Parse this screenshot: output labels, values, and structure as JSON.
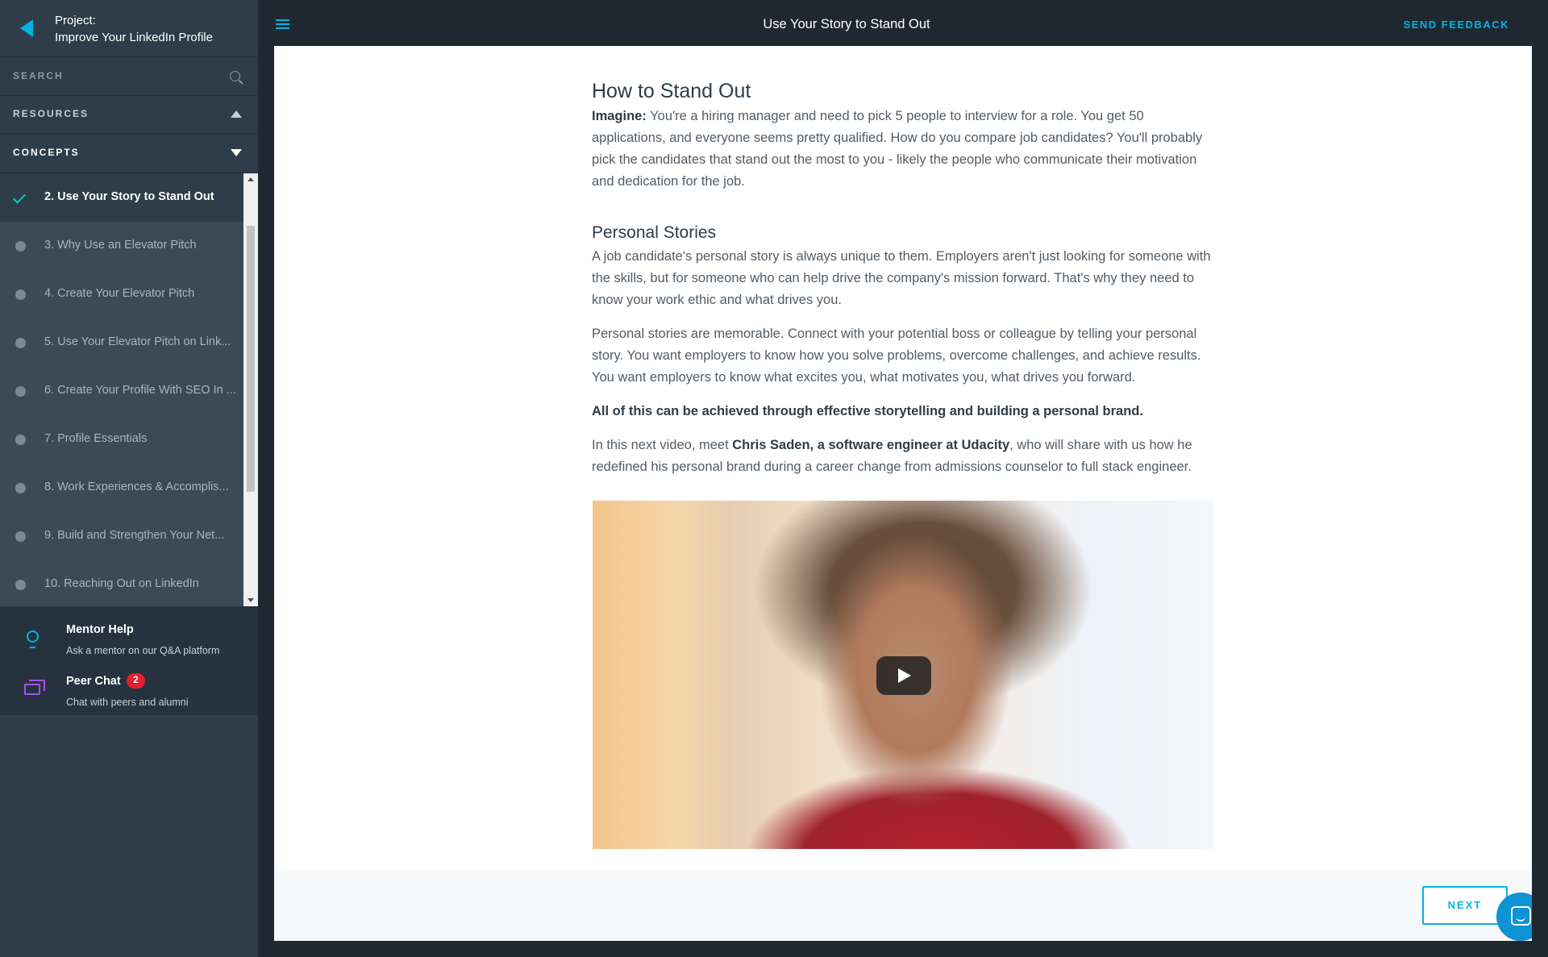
{
  "sidebar": {
    "project_label": "Project:",
    "project_name": "Improve Your LinkedIn Profile",
    "search_label": "SEARCH",
    "resources_label": "RESOURCES",
    "concepts_label": "CONCEPTS",
    "concepts": [
      {
        "label": "2. Use Your Story to Stand Out",
        "state": "completed-current"
      },
      {
        "label": "3. Why Use an Elevator Pitch",
        "state": "not-started"
      },
      {
        "label": "4. Create Your Elevator Pitch",
        "state": "not-started"
      },
      {
        "label": "5. Use Your Elevator Pitch on Link...",
        "state": "not-started"
      },
      {
        "label": "6. Create Your Profile With SEO In ...",
        "state": "not-started"
      },
      {
        "label": "7. Profile Essentials",
        "state": "not-started"
      },
      {
        "label": "8. Work Experiences & Accomplis...",
        "state": "not-started"
      },
      {
        "label": "9. Build and Strengthen Your Net...",
        "state": "not-started"
      },
      {
        "label": "10. Reaching Out on LinkedIn",
        "state": "not-started"
      }
    ],
    "mentor_help": {
      "title": "Mentor Help",
      "subtitle": "Ask a mentor on our Q&A platform",
      "icon": "lightbulb-icon"
    },
    "peer_chat": {
      "title": "Peer Chat",
      "badge": "2",
      "subtitle": "Chat with peers and alumni",
      "icon": "chat-bubbles-icon"
    }
  },
  "header": {
    "title": "Use Your Story to Stand Out",
    "send_feedback": "SEND FEEDBACK"
  },
  "article": {
    "heading": "How to Stand Out",
    "intro_bold": "Imagine:",
    "intro_text": " You're a hiring manager and need to pick 5 people to interview for a role. You get 50 applications, and everyone seems pretty qualified. How do you compare job candidates? You'll probably pick the candidates that stand out the most to you - likely the people who communicate their motivation and dedication for the job.",
    "subheading": "Personal Stories",
    "para1": "A job candidate's personal story is always unique to them. Employers aren't just looking for someone with the skills, but for someone who can help drive the company's mission forward. That's why they need to know your work ethic and what drives you.",
    "para2": "Personal stories are memorable. Connect with your potential boss or colleague by telling your personal story. You want employers to know how you solve problems, overcome challenges, and achieve results. You want employers to know what excites you, what motivates you, what drives you forward.",
    "para3_bold": "All of this can be achieved through effective storytelling and building a personal brand.",
    "para4_before": "In this next video, meet ",
    "para4_bold": "Chris Saden, a software engineer at Udacity",
    "para4_after": ", who will share with us how he redefined his personal brand during a career change from admissions counselor to full stack engineer."
  },
  "footer": {
    "next_label": "NEXT"
  },
  "colors": {
    "accent": "#02b3e4",
    "sidebar_bg": "#2e3d49",
    "topbar_bg": "#1f2831",
    "check": "#02ccba",
    "badge": "#e32030",
    "peer_icon": "#a451f7"
  }
}
